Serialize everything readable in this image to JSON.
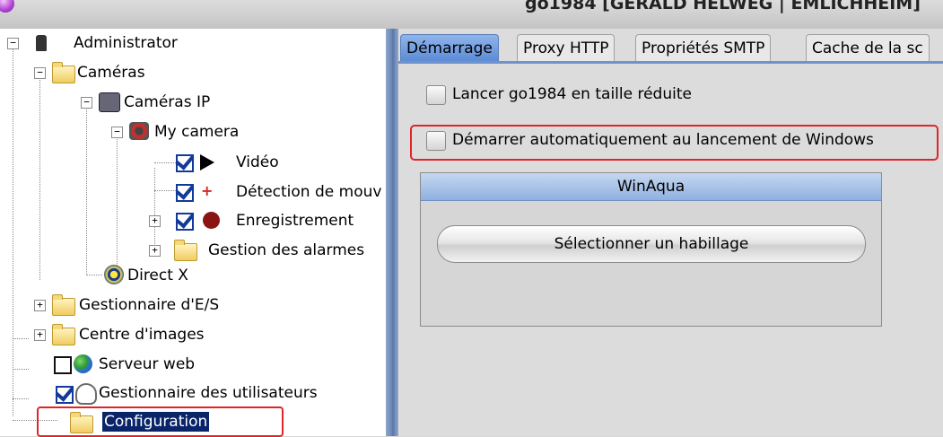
{
  "window": {
    "title": "go1984 [GERALD HELWEG | EMLICHHEIM]"
  },
  "tree": {
    "administrator": "Administrator",
    "cameras": "Caméras",
    "ip_cameras": "Caméras IP",
    "my_camera": "My camera",
    "video": "Vidéo",
    "motion_detection": "Détection de mouv",
    "recording": "Enregistrement",
    "alarm_management": "Gestion des alarmes",
    "directx": "Direct X",
    "io_manager": "Gestionnaire d'E/S",
    "image_center": "Centre d'images",
    "web_server": "Serveur web",
    "user_manager": "Gestionnaire des utilisateurs",
    "configuration": "Configuration"
  },
  "tree_checkbox_states": {
    "video": true,
    "motion_detection": true,
    "recording": true,
    "web_server": false,
    "user_manager": true
  },
  "tabs": [
    "Démarrage",
    "Proxy HTTP",
    "Propriétés SMTP",
    "Cache de la sc"
  ],
  "active_tab": "Démarrage",
  "options": {
    "start_minimized": {
      "label": "Lancer go1984 en taille réduite",
      "checked": false
    },
    "autostart": {
      "label": "Démarrer automatiquement au lancement de Windows",
      "checked": false
    }
  },
  "skin": {
    "header": "WinAqua",
    "button_label": "Sélectionner un habillage"
  },
  "colors": {
    "highlight_red": "#e0242a",
    "tab_active": "#6f93cc",
    "selection": "#0a246a"
  }
}
